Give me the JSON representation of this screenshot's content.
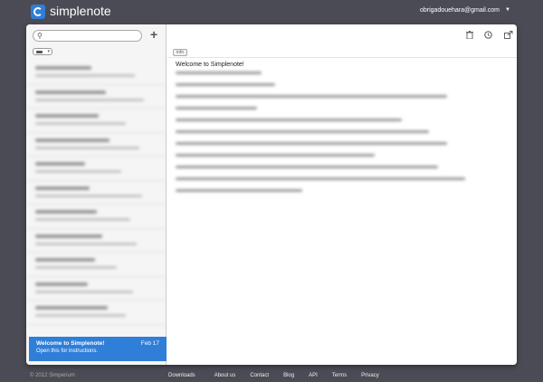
{
  "header": {
    "brand": "simplenote",
    "account": "obrigadouehara@gmail.com",
    "account_caret": "▼"
  },
  "sidebar": {
    "add_label": "+",
    "active_note": {
      "title": "Welcome to Simplenote!",
      "date": "Feb 17",
      "preview": "Open this for instructions."
    }
  },
  "main": {
    "info_tag": "info",
    "note_title": "Welcome to Simplenote!"
  },
  "footer": {
    "copyright": "© 2012 Simperium",
    "links": [
      "Downloads",
      "About us",
      "Contact",
      "Blog",
      "API",
      "Terms",
      "Privacy"
    ]
  },
  "colors": {
    "accent": "#2f7ed8",
    "background": "#4b4b55"
  }
}
